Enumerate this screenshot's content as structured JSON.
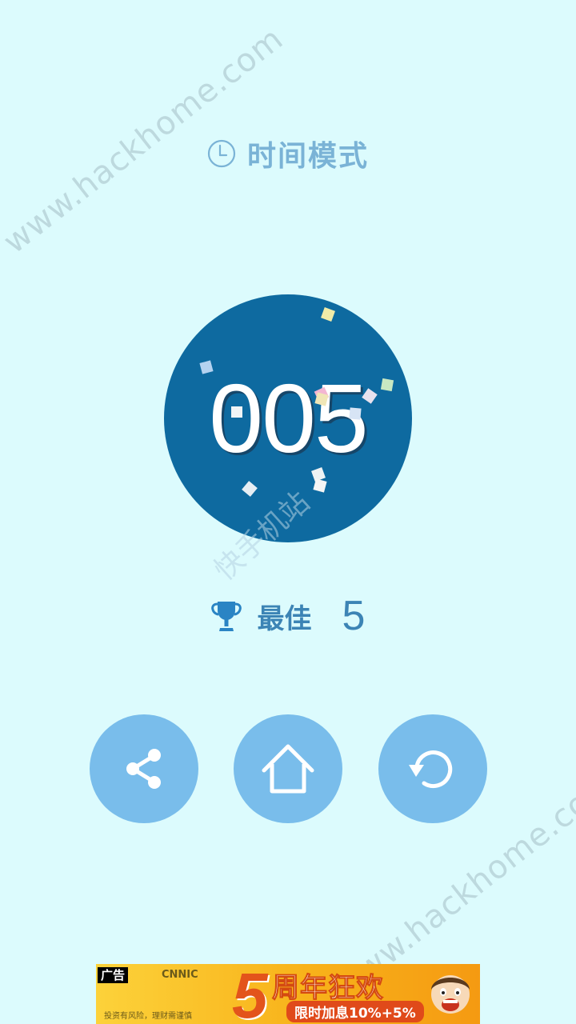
{
  "watermark": {
    "text": "www.hackhome.com",
    "overlay": "快手机站"
  },
  "header": {
    "mode_label": "时间模式",
    "mode_icon": "clock-icon"
  },
  "score": {
    "value": "005"
  },
  "best": {
    "icon": "trophy-icon",
    "label": "最佳",
    "value": "5"
  },
  "actions": [
    {
      "name": "share",
      "icon": "share-icon"
    },
    {
      "name": "home",
      "icon": "home-icon"
    },
    {
      "name": "restart",
      "icon": "restart-icon"
    }
  ],
  "ad": {
    "tag": "广告",
    "brand": "CNNIC",
    "number": "5",
    "headline": "周年狂欢",
    "subline": "限时加息10%+5%",
    "small_text": "投资有风险，理财需谨慎"
  },
  "colors": {
    "background": "#dcfbfd",
    "score_circle": "#0e6aa0",
    "button_fill": "#79bdeb",
    "accent_text": "#3c84b5",
    "mode_text": "#7ab3d6"
  }
}
